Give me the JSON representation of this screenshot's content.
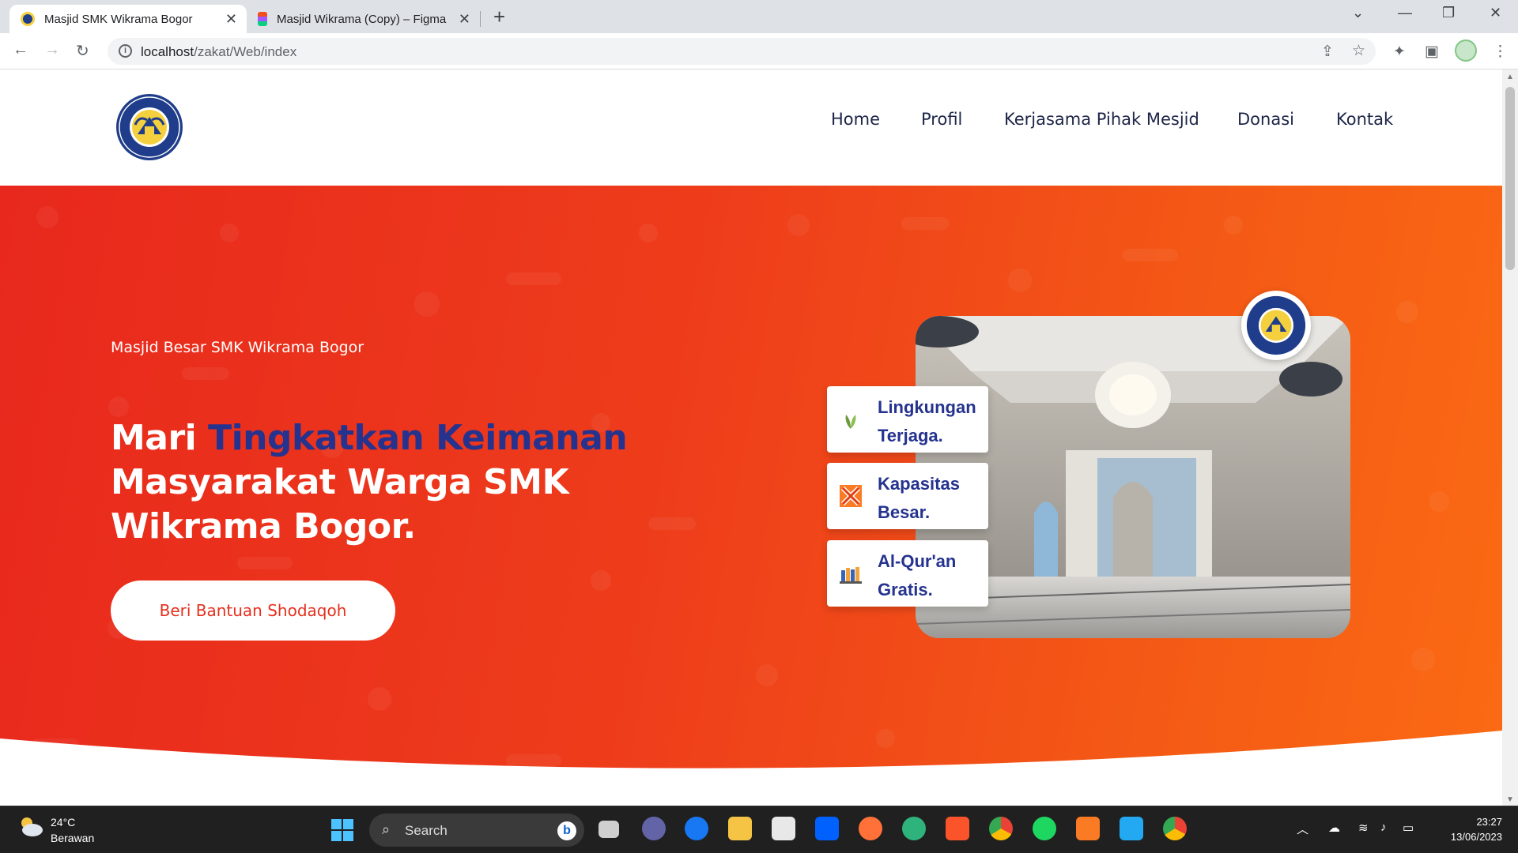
{
  "browser": {
    "tabs": [
      {
        "title": "Masjid SMK Wikrama Bogor",
        "active": true
      },
      {
        "title": "Masjid Wikrama (Copy) – Figma",
        "active": false
      }
    ],
    "url_host": "localhost",
    "url_path": "/zakat/Web/index"
  },
  "nav": {
    "items": [
      "Home",
      "Profil",
      "Kerjasama Pihak Mesjid",
      "Donasi",
      "Kontak"
    ]
  },
  "logo": {
    "top_text": "SMK WIKRAMA",
    "bottom_text": "KOTA BOGOR"
  },
  "hero": {
    "eyebrow": "Masjid Besar SMK Wikrama Bogor",
    "headline_pre": "Mari ",
    "headline_highlight": "Tingkatkan Keimanan",
    "headline_post": " Masyarakat Warga SMK Wikrama Bogor.",
    "cta_label": "Beri Bantuan Shodaqoh",
    "features": [
      {
        "text": "Lingkungan Terjaga.",
        "icon": "leaf-icon"
      },
      {
        "text": "Kapasitas Besar.",
        "icon": "xampp-like-icon"
      },
      {
        "text": "Al-Qur'an Gratis.",
        "icon": "books-icon"
      }
    ]
  },
  "taskbar": {
    "weather_temp": "24°C",
    "weather_cond": "Berawan",
    "search_label": "Search",
    "time": "23:27",
    "date": "13/06/2023"
  },
  "colors": {
    "hero_start": "#e8281d",
    "hero_end": "#fb6a13",
    "highlight": "#25338f",
    "nav_text": "#1d2548"
  }
}
